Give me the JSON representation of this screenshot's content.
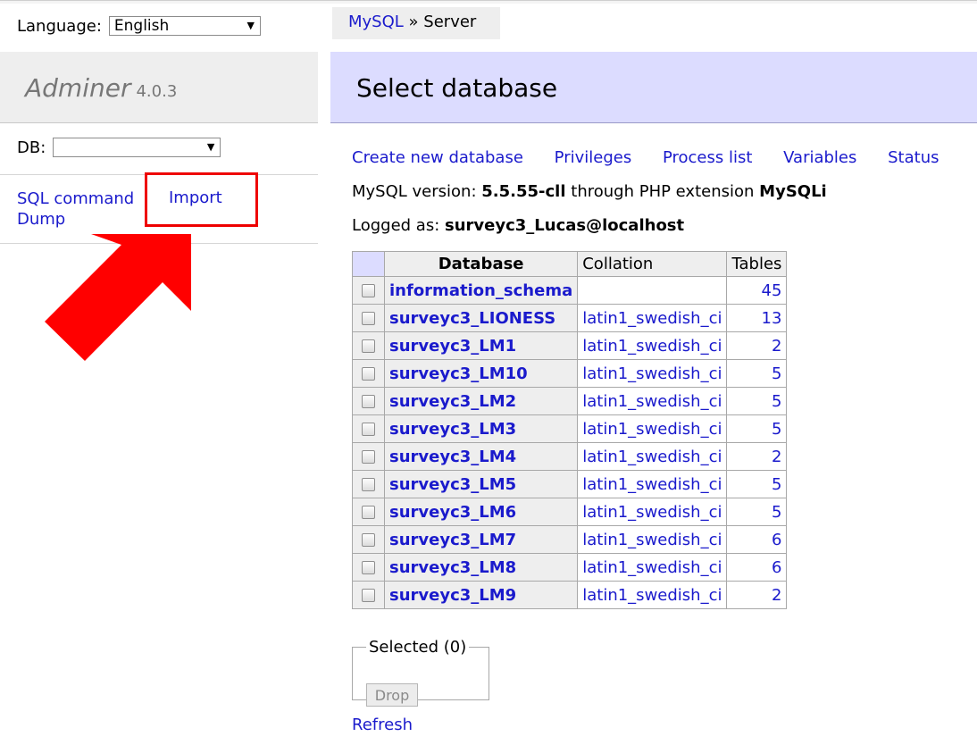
{
  "menu": {
    "language_label": "Language:",
    "language_value": "English",
    "app_name": "Adminer",
    "version": "4.0.3",
    "db_label": "DB:",
    "db_value": "",
    "sql_command": "SQL command",
    "dump": "Dump",
    "import": "Import"
  },
  "breadcrumb": {
    "root": "MySQL",
    "separator": "»",
    "current": "Server"
  },
  "page_title": "Select database",
  "links": [
    "Create new database",
    "Privileges",
    "Process list",
    "Variables",
    "Status"
  ],
  "version_info": {
    "prefix": "MySQL version:",
    "version": "5.5.55-cll",
    "middle": "through PHP extension",
    "extension": "MySQLi"
  },
  "logged": {
    "prefix": "Logged as:",
    "user": "surveyc3_Lucas@localhost"
  },
  "table": {
    "headers": {
      "database": "Database",
      "collation": "Collation",
      "tables": "Tables"
    },
    "rows": [
      {
        "name": "information_schema",
        "collation": "",
        "tables": "45"
      },
      {
        "name": "surveyc3_LIONESS",
        "collation": "latin1_swedish_ci",
        "tables": "13"
      },
      {
        "name": "surveyc3_LM1",
        "collation": "latin1_swedish_ci",
        "tables": "2"
      },
      {
        "name": "surveyc3_LM10",
        "collation": "latin1_swedish_ci",
        "tables": "5"
      },
      {
        "name": "surveyc3_LM2",
        "collation": "latin1_swedish_ci",
        "tables": "5"
      },
      {
        "name": "surveyc3_LM3",
        "collation": "latin1_swedish_ci",
        "tables": "5"
      },
      {
        "name": "surveyc3_LM4",
        "collation": "latin1_swedish_ci",
        "tables": "2"
      },
      {
        "name": "surveyc3_LM5",
        "collation": "latin1_swedish_ci",
        "tables": "5"
      },
      {
        "name": "surveyc3_LM6",
        "collation": "latin1_swedish_ci",
        "tables": "5"
      },
      {
        "name": "surveyc3_LM7",
        "collation": "latin1_swedish_ci",
        "tables": "6"
      },
      {
        "name": "surveyc3_LM8",
        "collation": "latin1_swedish_ci",
        "tables": "6"
      },
      {
        "name": "surveyc3_LM9",
        "collation": "latin1_swedish_ci",
        "tables": "2"
      }
    ]
  },
  "selected": {
    "legend": "Selected (0)",
    "drop_label": "Drop"
  },
  "refresh": "Refresh",
  "colors": {
    "link": "#1a1acc",
    "heading_bg": "#dcdcff",
    "highlight": "#ee0000"
  },
  "icons": {
    "annotation": "red-arrow-icon",
    "dropdown": "chevron-down-icon"
  }
}
